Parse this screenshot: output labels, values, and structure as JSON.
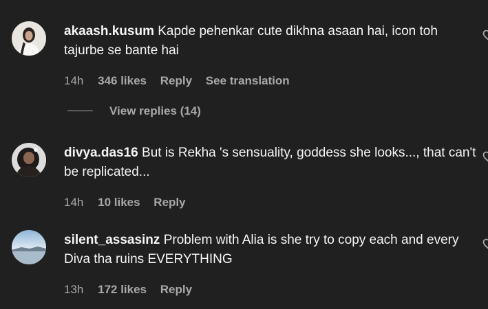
{
  "comments": [
    {
      "username": "akaash.kusum",
      "text": " Kapde pehenkar cute dikhna asaan hai, icon toh tajurbe se bante hai",
      "time": "14h",
      "likes": "346 likes",
      "reply": "Reply",
      "translation": "See translation",
      "view_replies": "View replies (14)"
    },
    {
      "username": "divya.das16",
      "text": " But is Rekha 's sensuality, goddess she looks..., that can't be replicated...",
      "time": "14h",
      "likes": "10 likes",
      "reply": "Reply"
    },
    {
      "username": "silent_assasinz",
      "text": " Problem with Alia is she try to copy each and every Diva tha ruins EVERYTHING",
      "time": "13h",
      "likes": "172 likes",
      "reply": "Reply"
    }
  ],
  "icons": {
    "like": "heart-icon"
  }
}
